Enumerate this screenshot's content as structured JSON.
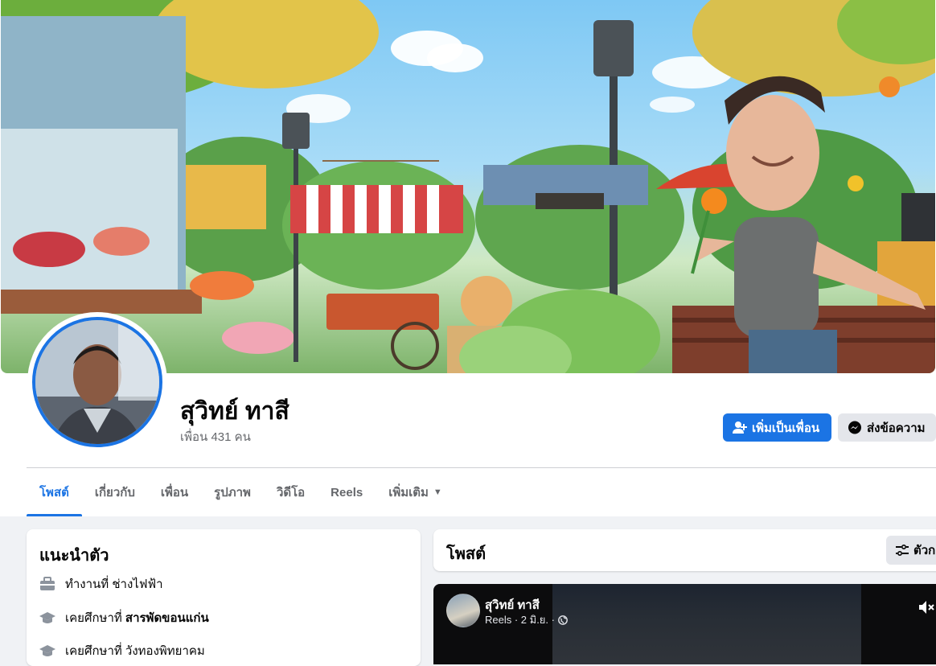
{
  "profile": {
    "name": "สุวิทย์ ทาสี",
    "friend_count": "เพื่อน 431 คน"
  },
  "actions": {
    "add_friend": "เพิ่มเป็นเพื่อน",
    "message": "ส่งข้อความ"
  },
  "tabs": [
    {
      "label": "โพสต์",
      "active": true
    },
    {
      "label": "เกี่ยวกับ"
    },
    {
      "label": "เพื่อน"
    },
    {
      "label": "รูปภาพ"
    },
    {
      "label": "วิดีโอ"
    },
    {
      "label": "Reels"
    },
    {
      "label": "เพิ่มเติม"
    }
  ],
  "intro": {
    "title": "แนะนำตัว",
    "rows": [
      {
        "icon": "briefcase-icon",
        "prefix": "ทำงานที่ ช่างไฟฟ้า",
        "bold": ""
      },
      {
        "icon": "graduation-cap-icon",
        "prefix": "เคยศึกษาที่ ",
        "bold": "สารพัดขอนแก่น"
      },
      {
        "icon": "graduation-cap-icon",
        "prefix": "เคยศึกษาที่ วังทองพิทยาคม",
        "bold": ""
      }
    ]
  },
  "posts": {
    "title": "โพสต์",
    "filter_label": "ตัวก"
  },
  "reel": {
    "author": "สุวิทย์ ทาสี",
    "meta": "Reels · 2 มิ.ย. ·",
    "privacy_icon": "globe-icon"
  },
  "colors": {
    "accent": "#1b74e4",
    "background": "#f0f2f5",
    "secondary_button": "#e4e6eb",
    "muted_text": "#65676b"
  }
}
